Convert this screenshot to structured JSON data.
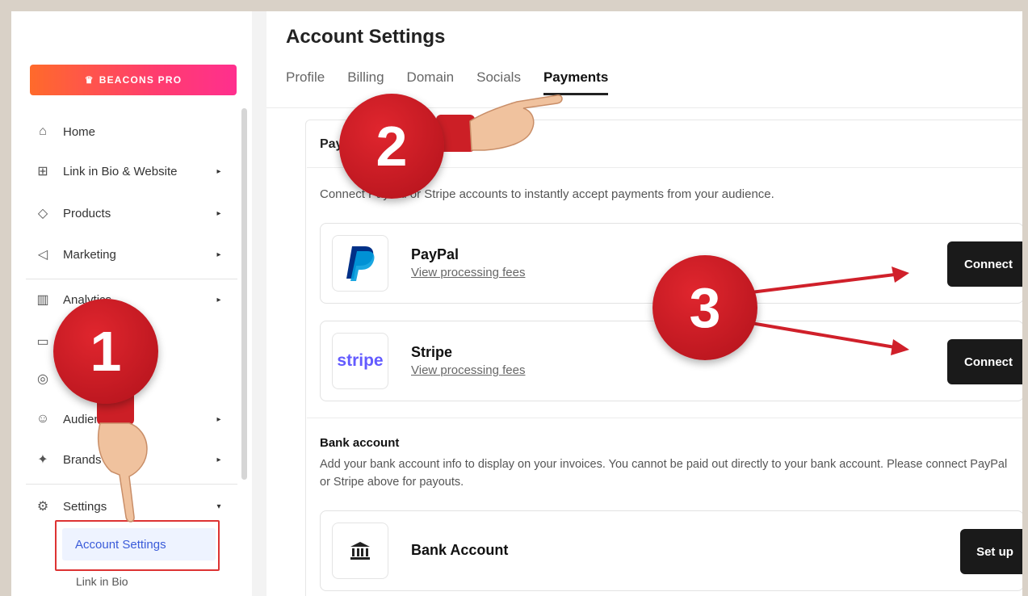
{
  "sidebar": {
    "pro_label": "BEACONS PRO",
    "items": [
      {
        "label": "Home",
        "icon": "home-icon",
        "glyph": "⌂",
        "arrow": ""
      },
      {
        "label": "Link in Bio & Website",
        "icon": "grid-plus-icon",
        "glyph": "⊞",
        "arrow": "▸"
      },
      {
        "label": "Products",
        "icon": "tag-icon",
        "glyph": "◇",
        "arrow": "▸"
      },
      {
        "label": "Marketing",
        "icon": "megaphone-icon",
        "glyph": "◁",
        "arrow": "▸"
      },
      {
        "label": "Analytics",
        "icon": "bar-chart-icon",
        "glyph": "▥",
        "arrow": "▸"
      },
      {
        "label": "",
        "icon": "inbox-icon",
        "glyph": "▭",
        "arrow": ""
      },
      {
        "label": "",
        "icon": "coins-icon",
        "glyph": "◎",
        "arrow": ""
      },
      {
        "label": "Audience",
        "icon": "users-icon",
        "glyph": "☺",
        "arrow": "▸"
      },
      {
        "label": "Brands",
        "icon": "handshake-icon",
        "glyph": "✦",
        "arrow": "▸"
      },
      {
        "label": "Settings",
        "icon": "gear-icon",
        "glyph": "⚙",
        "arrow": "▾"
      }
    ],
    "sub_active": "Account Settings",
    "sub_next": "Link in Bio"
  },
  "header": {
    "title": "Account Settings",
    "tabs": [
      "Profile",
      "Billing",
      "Domain",
      "Socials",
      "Payments"
    ],
    "active_tab": "Payments"
  },
  "payments": {
    "heading": "Pay",
    "description": "Connect PayPal or Stripe accounts to instantly accept payments from your audience.",
    "providers": [
      {
        "name": "PayPal",
        "link": "View processing fees",
        "button": "Connect"
      },
      {
        "name": "Stripe",
        "link": "View processing fees",
        "button": "Connect",
        "logo_text": "stripe"
      }
    ]
  },
  "bank": {
    "heading": "Bank account",
    "description": "Add your bank account info to display on your invoices. You cannot be paid out directly to your bank account. Please connect PayPal or Stripe above for payouts.",
    "card_name": "Bank Account",
    "button": "Set up"
  },
  "annotations": {
    "step1": "1",
    "step2": "2",
    "step3": "3"
  },
  "colors": {
    "pro_gradient_start": "#ff6a2b",
    "pro_gradient_end": "#ff2f8e",
    "annotation_red": "#d0202a",
    "active_link": "#3a5bd9",
    "paypal_dark": "#003087",
    "paypal_light": "#009cde",
    "stripe": "#635bff"
  }
}
